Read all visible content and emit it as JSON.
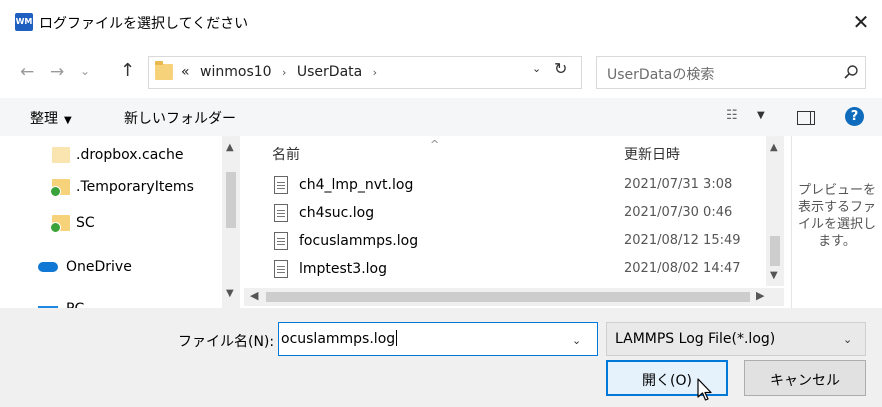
{
  "window": {
    "title": "ログファイルを選択してください",
    "app_icon": "WM"
  },
  "nav": {
    "back": "←",
    "forward": "→",
    "history": "⌄",
    "up": "↑"
  },
  "address": {
    "prefix": "«",
    "crumbs": [
      "winmos10",
      "UserData"
    ],
    "separator": "›",
    "refresh": "↻"
  },
  "search": {
    "placeholder": "UserDataの検索"
  },
  "toolbar": {
    "organize_label": "整理",
    "organize_caret": "▼",
    "new_folder_label": "新しいフォルダー",
    "view_icon": "☷",
    "view_caret": "▼",
    "help": "?"
  },
  "nav_pane": {
    "items": [
      {
        "label": ".dropbox.cache",
        "icon": "folder-icon"
      },
      {
        "label": ".TemporaryItems",
        "icon": "synced-folder-icon"
      },
      {
        "label": "SC",
        "icon": "synced-folder-icon"
      },
      {
        "label": "OneDrive",
        "icon": "onedrive-cloud-icon"
      },
      {
        "label": "PC",
        "icon": "pc-icon"
      }
    ]
  },
  "file_list": {
    "columns": {
      "name": "名前",
      "date": "更新日時"
    },
    "files": [
      {
        "name": "ch4_lmp_nvt.log",
        "date": "2021/07/31 3:08"
      },
      {
        "name": "ch4suc.log",
        "date": "2021/07/30 0:46"
      },
      {
        "name": "focuslammps.log",
        "date": "2021/08/12 15:49"
      },
      {
        "name": "lmptest3.log",
        "date": "2021/08/02 14:47"
      }
    ]
  },
  "preview": {
    "message": "プレビューを表示するファイルを選択します。"
  },
  "bottom": {
    "filename_label": "ファイル名(N):",
    "filename_value": "ocuslammps.log",
    "filetype_value": "LAMMPS Log File(*.log)",
    "open_label": "開く(O)",
    "cancel_label": "キャンセル"
  },
  "colors": {
    "accent": "#0078d7",
    "help": "#0f6cbd",
    "folder": "#f6d37b"
  }
}
